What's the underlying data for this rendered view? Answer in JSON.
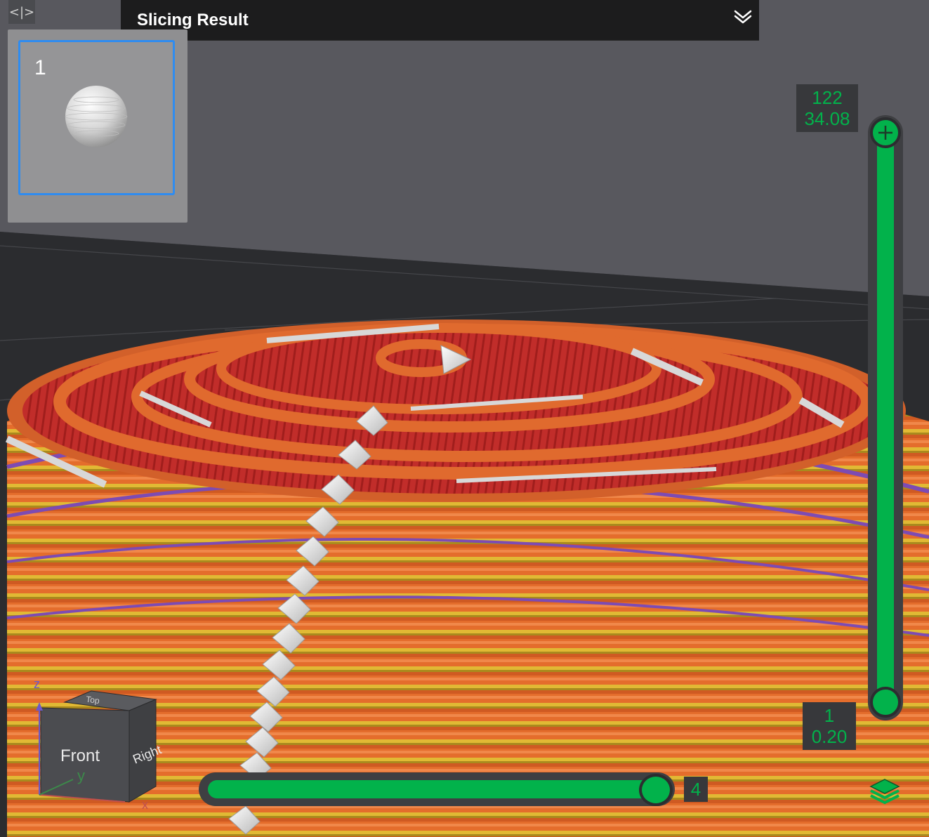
{
  "header": {
    "title": "Slicing Result"
  },
  "toolbar": {
    "panel_toggle_icon": "<|>"
  },
  "plates": [
    {
      "index": "1",
      "thumbnail_icon": "sphere-icon"
    }
  ],
  "layer_slider": {
    "top_layer": "122",
    "top_height": "34.08",
    "bottom_layer": "1",
    "bottom_height": "0.20",
    "fill_fraction": 1.0
  },
  "move_slider": {
    "value": "4",
    "fill_fraction": 1.0
  },
  "view_cube": {
    "front": "Front",
    "right": "Right",
    "top": "Top",
    "axis_z": "z",
    "axis_y": "y",
    "axis_x": "x"
  },
  "colors": {
    "accent": "#02b24b",
    "selection": "#2f8cf0",
    "outer_wall": "#d9622b",
    "inner_wall": "#e0b52f",
    "top_surface": "#c8322d",
    "overhang": "#7a4bb0",
    "seam": "#ffffff"
  }
}
